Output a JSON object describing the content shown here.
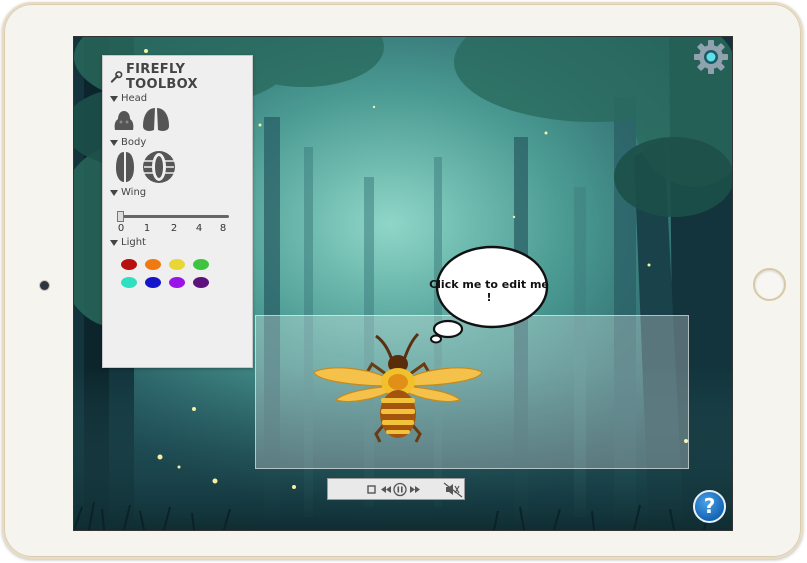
{
  "toolbox": {
    "title": "FIREFLY TOOLBOX",
    "head_label": "Head",
    "body_label": "Body",
    "wing_label": "Wing",
    "light_label": "Light",
    "wing_ticks": [
      "0",
      "1",
      "2",
      "4",
      "8"
    ],
    "wing_value": "0",
    "light_colors": [
      "#b80f0f",
      "#f07a12",
      "#e8d636",
      "#40c440",
      "#2ee0c0",
      "#1414c8",
      "#9a14e8",
      "#5c127a"
    ],
    "head_icons": [
      "round-head-icon",
      "split-head-icon"
    ],
    "body_icons": [
      "striped-body-icon",
      "shell-body-icon"
    ]
  },
  "speech_bubble": {
    "text": "Click me to edit me !"
  },
  "player": {
    "controls": [
      "stop-icon",
      "rewind-icon",
      "pause-icon",
      "fast-forward-icon",
      "mute-icon"
    ]
  },
  "help_button": {
    "label": "?"
  },
  "colors": {
    "forest_bg": "#3b7f7e",
    "panel_bg": "#efefef",
    "help_blue": "#1f7ccc"
  }
}
